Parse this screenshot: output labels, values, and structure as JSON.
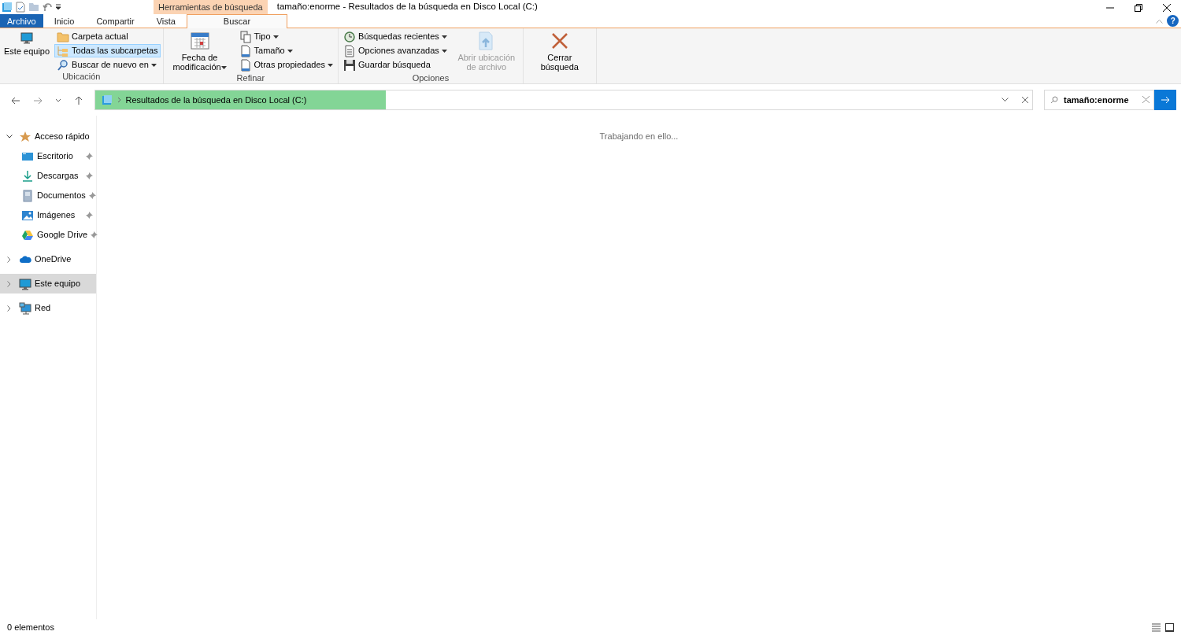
{
  "title_bar": {
    "context_tab": "Herramientas de búsqueda",
    "title": "tamaño:enorme - Resultados de la búsqueda en Disco Local (C:)",
    "help": "?"
  },
  "ribbon_tabs": [
    {
      "label": "Archivo",
      "kind": "file",
      "selected": false
    },
    {
      "label": "Inicio",
      "kind": "tab",
      "selected": false
    },
    {
      "label": "Compartir",
      "kind": "tab",
      "selected": false
    },
    {
      "label": "Vista",
      "kind": "tab",
      "selected": false
    },
    {
      "label": "Buscar",
      "kind": "context",
      "selected": true
    }
  ],
  "ribbon_groups": [
    {
      "label": "Ubicación",
      "columns": [
        [
          {
            "kind": "large",
            "label": "Este equipo",
            "dropdown": false,
            "disabled": false
          }
        ],
        [
          {
            "kind": "small",
            "label": "Carpeta actual",
            "dropdown": false,
            "selected": false
          },
          {
            "kind": "small",
            "label": "Todas las subcarpetas",
            "dropdown": false,
            "selected": true
          },
          {
            "kind": "small",
            "label": "Buscar de nuevo en",
            "dropdown": true,
            "selected": false
          }
        ]
      ]
    },
    {
      "label": "Refinar",
      "columns": [
        [
          {
            "kind": "large",
            "label": "Fecha de modificación",
            "dropdown": true,
            "disabled": false
          }
        ],
        [
          {
            "kind": "small",
            "label": "Tipo",
            "dropdown": true,
            "selected": false
          },
          {
            "kind": "small",
            "label": "Tamaño",
            "dropdown": true,
            "selected": false
          },
          {
            "kind": "small",
            "label": "Otras propiedades",
            "dropdown": true,
            "selected": false
          }
        ]
      ]
    },
    {
      "label": "Opciones",
      "columns": [
        [
          {
            "kind": "small",
            "label": "Búsquedas recientes",
            "dropdown": true,
            "selected": false
          },
          {
            "kind": "small",
            "label": "Opciones avanzadas",
            "dropdown": true,
            "selected": false
          },
          {
            "kind": "small",
            "label": "Guardar búsqueda",
            "dropdown": false,
            "selected": false
          }
        ],
        [
          {
            "kind": "large",
            "label": "Abrir ubicación de archivo",
            "dropdown": false,
            "disabled": true
          }
        ]
      ]
    },
    {
      "columns": [
        [
          {
            "kind": "large",
            "label": "Cerrar búsqueda",
            "dropdown": false,
            "disabled": false
          }
        ]
      ]
    }
  ],
  "address_bar": {
    "path": "Resultados de la búsqueda en Disco Local (C:)",
    "level": 0.31
  },
  "search": {
    "value": "tamaño:enorme"
  },
  "sidebar": {
    "items": [
      {
        "label": "Acceso rápido",
        "expanded": true,
        "selected": false,
        "children": [
          {
            "label": "Escritorio",
            "pinned": true
          },
          {
            "label": "Descargas",
            "pinned": true
          },
          {
            "label": "Documentos",
            "pinned": true
          },
          {
            "label": "Imágenes",
            "pinned": true
          },
          {
            "label": "Google Drive",
            "pinned": true
          }
        ]
      },
      {
        "label": "OneDrive",
        "expanded": false,
        "selected": false
      },
      {
        "label": "Este equipo",
        "expanded": false,
        "selected": true
      },
      {
        "label": "Red",
        "expanded": false,
        "selected": false
      }
    ]
  },
  "content": {
    "message": "Trabajando en ello..."
  },
  "status_bar": {
    "count": "0 elementos"
  }
}
